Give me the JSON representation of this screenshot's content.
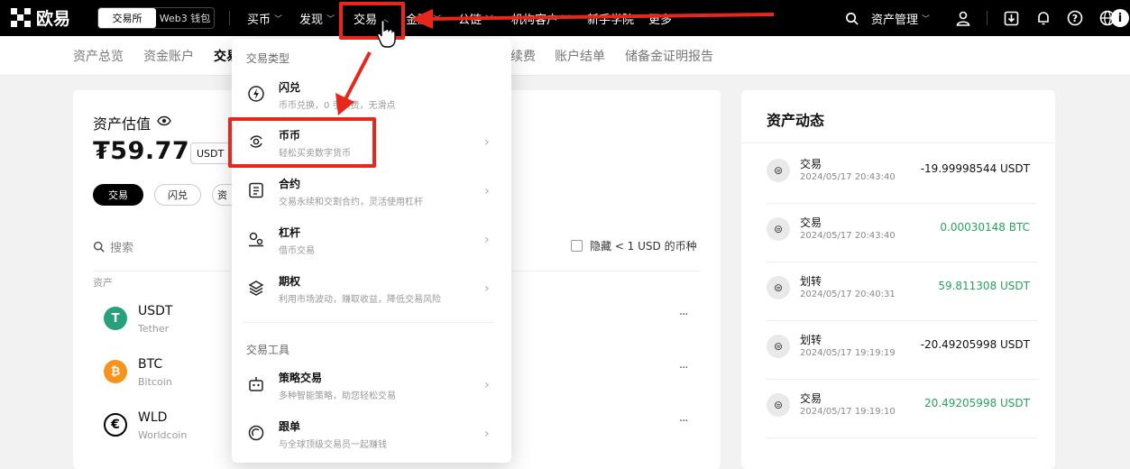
{
  "topnav": {
    "brand": "欧易",
    "segment": {
      "exchange": "交易所",
      "web3": "Web3 钱包"
    },
    "menu": [
      "买币",
      "发现",
      "交易",
      "金融",
      "公链",
      "机构客户",
      "新手学院",
      "更多"
    ],
    "right": {
      "asset_mgmt": "资产管理"
    }
  },
  "subnav": [
    "资产总览",
    "资金账户",
    "交易",
    "续费",
    "账户结单",
    "储备金证明报告"
  ],
  "asset": {
    "title": "资产估值",
    "value": "₮59.77",
    "unit": "USDT",
    "pills": [
      "交易",
      "闪兑",
      "资"
    ],
    "search_placeholder": "搜索",
    "hide_small": "隐藏 < 1 USD 的币种",
    "col_asset": "资产",
    "rows": [
      {
        "symbol": "USDT",
        "name": "Tether",
        "color": "#26a17b",
        "glyph": "T"
      },
      {
        "symbol": "BTC",
        "name": "Bitcoin",
        "color": "#f7931a",
        "glyph": "₿"
      },
      {
        "symbol": "WLD",
        "name": "Worldcoin",
        "color": "#ffffff",
        "glyph": "€"
      }
    ],
    "more": "···"
  },
  "activity": {
    "title": "资产动态",
    "rows": [
      {
        "type": "交易",
        "time": "2024/05/17 20:43:40",
        "amount": "-19.99998544 USDT",
        "positive": false
      },
      {
        "type": "交易",
        "time": "2024/05/17 20:43:40",
        "amount": "0.00030148 BTC",
        "positive": true
      },
      {
        "type": "划转",
        "time": "2024/05/17 20:40:31",
        "amount": "59.811308 USDT",
        "positive": true
      },
      {
        "type": "划转",
        "time": "2024/05/17 19:19:19",
        "amount": "-20.49205998 USDT",
        "positive": false
      },
      {
        "type": "交易",
        "time": "2024/05/17 19:19:10",
        "amount": "20.49205998 USDT",
        "positive": true
      }
    ]
  },
  "dropdown": {
    "section1": "交易类型",
    "section2": "交易工具",
    "items": [
      {
        "title": "闪兑",
        "desc": "币币兑换，0 手续费，无滑点",
        "icon": "flash-icon"
      },
      {
        "title": "币币",
        "desc": "轻松买卖数字货币",
        "icon": "spot-icon"
      },
      {
        "title": "合约",
        "desc": "交易永续和交割合约，灵活使用杠杆",
        "icon": "contract-icon"
      },
      {
        "title": "杠杆",
        "desc": "借币交易",
        "icon": "leverage-icon"
      },
      {
        "title": "期权",
        "desc": "利用市场波动，赚取收益，降低交易风险",
        "icon": "options-icon"
      },
      {
        "title": "策略交易",
        "desc": "多种智能策略，助您轻松交易",
        "icon": "bot-icon"
      },
      {
        "title": "跟单",
        "desc": "与全球顶级交易员一起赚钱",
        "icon": "copy-trade-icon"
      }
    ]
  },
  "colors": {
    "highlight": "#e8271c",
    "positive": "#27a35a"
  }
}
